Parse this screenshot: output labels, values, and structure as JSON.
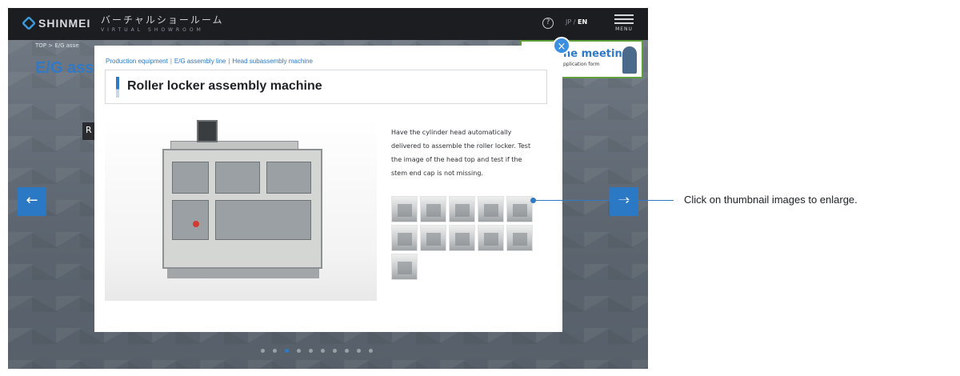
{
  "header": {
    "logo": "SHINMEI",
    "site_title_jp": "バーチャルショールーム",
    "site_title_en": "VIRTUAL SHOWROOM",
    "lang_jp": "JP",
    "lang_sep": "/",
    "lang_en": "EN",
    "menu_label": "MENU",
    "help_glyph": "?"
  },
  "background": {
    "breadcrumb": "TOP > E/G asse",
    "page_heading": "E/G ass",
    "floating_label": "R",
    "meeting_banner_title": "ne meeting",
    "meeting_banner_sub": "pplication form",
    "prev_arrow": "←",
    "next_arrow": "→",
    "slide_count": 10,
    "active_slide": 3
  },
  "modal": {
    "breadcrumb": [
      "Production equipment",
      "E/G assembly line",
      "Head subassembly machine"
    ],
    "breadcrumb_sep": "|",
    "title": "Roller locker assembly machine",
    "description": "Have the cylinder head automatically delivered to assemble the roller locker. Test the image of the head top and test if the stem end cap is not missing.",
    "thumbnail_count": 11,
    "close_glyph": "×"
  },
  "annotation": {
    "text": "Click on thumbnail images to enlarge."
  },
  "colors": {
    "accent": "#2f79c6",
    "header_bg": "#1c1d20",
    "close_button": "#3a8fe0"
  }
}
